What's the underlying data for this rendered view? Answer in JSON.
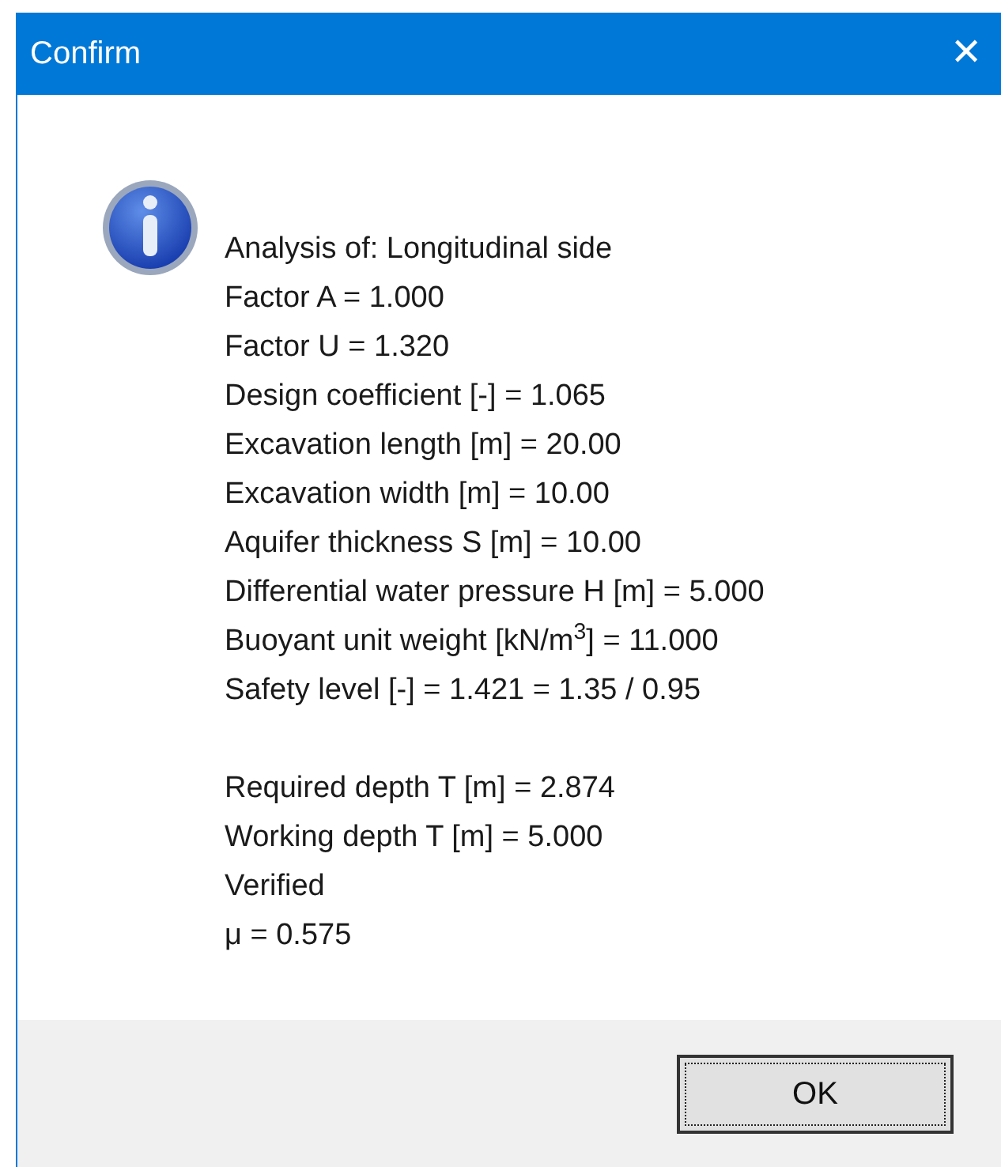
{
  "window": {
    "title": "Confirm",
    "close": "✕"
  },
  "message": {
    "paragraphs": [
      [
        "Analysis of: Longitudinal side",
        "Factor A = 1.000",
        "Factor U = 1.320",
        "Design coefficient [-] = 1.065",
        "Excavation length [m] = 20.00",
        "Excavation width [m] = 10.00",
        "Aquifer thickness S [m] = 10.00",
        "Differential water pressure H [m] = 5.000",
        "Buoyant unit weight [kN/m$^{3}$] = 11.000",
        "Safety level [-] = 1.421 = 1.35 / 0.95"
      ],
      [
        "Required depth T [m] = 2.874",
        "Working depth T [m] = 5.000",
        "Verified",
        "μ = 0.575"
      ]
    ]
  },
  "buttons": [
    {
      "label": "OK",
      "focused": true
    }
  ]
}
